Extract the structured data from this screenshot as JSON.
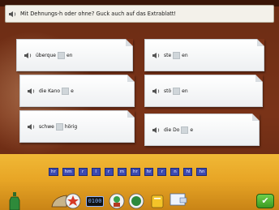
{
  "instruction": {
    "text": "Mit Dehnungs-h oder ohne? Guck auch auf das Extrablatt!"
  },
  "cards": [
    {
      "before": "überque",
      "after": "en"
    },
    {
      "before": "ste",
      "after": "en"
    },
    {
      "before": "die Kano",
      "after": "e"
    },
    {
      "before": "stö",
      "after": "en"
    },
    {
      "before": "schwe",
      "after": "hörig"
    },
    {
      "before": "die Do",
      "after": "e"
    }
  ],
  "tiles": [
    "hr",
    "hm",
    "r",
    "l",
    "r",
    "m",
    "hr",
    "hr",
    "r",
    "n",
    "hl",
    "hn"
  ],
  "toolbar": {
    "clock": "0100",
    "check": "✔"
  },
  "colors": {
    "background": "#7a3318",
    "floor": "#f0b836",
    "tile": "#3d4ab0",
    "check": "#3b9a22"
  }
}
